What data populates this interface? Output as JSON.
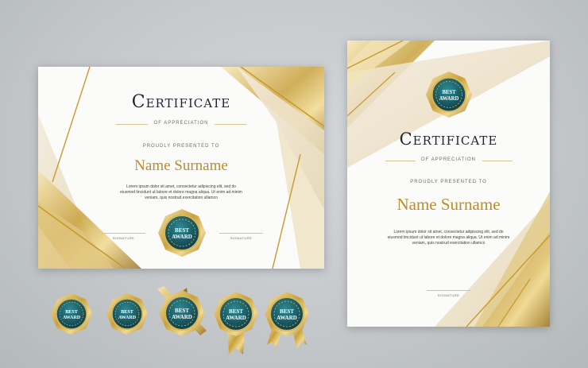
{
  "landscape": {
    "title": "Certificate",
    "subtitle": "OF APPRECIATION",
    "presented": "PROUDLY PRESENTED TO",
    "name": "Name Surname",
    "body_line1": "Lorem ipsum dolor sit amet, consectetur adipiscing elit, sed do",
    "body_line2": "eiusmod tincidunt ut labore et dolore magna aliqua. Ut enim ad minim",
    "body_line3": "veniam, quis nostrud exercitation ullamco",
    "signature_left": "SIGNATURE",
    "signature_right": "SIGNATURE",
    "seal_line1": "BEST",
    "seal_line2": "AWARD"
  },
  "portrait": {
    "title": "Certificate",
    "subtitle": "OF APPRECIATION",
    "presented": "PROUDLY PRESENTED TO",
    "name": "Name Surname",
    "body_line1": "Lorem ipsum dolor sit amet, consectetur adipiscing elit, sed do",
    "body_line2": "eiusmod tincidunt ut labore et dolore magna aliqua. Ut enim ad minim",
    "body_line3": "veniam, quis nostrud exercitation ullamco",
    "signature": "SIGNATURE",
    "seal_line1": "BEST",
    "seal_line2": "AWARD"
  },
  "badges": [
    {
      "line1": "BEST",
      "line2": "AWARD",
      "style": "plain"
    },
    {
      "line1": "BEST",
      "line2": "AWARD",
      "style": "plain"
    },
    {
      "line1": "BEST",
      "line2": "AWARD",
      "style": "ribbon-cross"
    },
    {
      "line1": "BEST",
      "line2": "AWARD",
      "style": "ribbon-tail"
    },
    {
      "line1": "BEST",
      "line2": "AWARD",
      "style": "ribbon-split"
    }
  ],
  "colors": {
    "gold": "#c9a13d",
    "gold_light": "#ead9a6",
    "navy": "#1f2433",
    "teal": "#1d6b74",
    "background": "#c6cacd"
  }
}
